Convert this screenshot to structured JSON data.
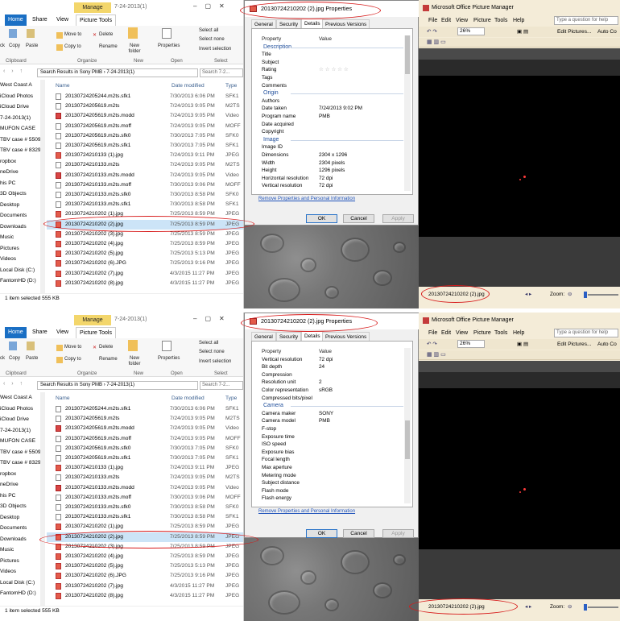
{
  "explorer": {
    "manage_tab": "Manage",
    "folder_title": "7-24-2013(1)",
    "tabs": [
      "Home",
      "Share",
      "View",
      "Picture Tools"
    ],
    "ribbon": {
      "cut": "ck",
      "copy": "Copy",
      "paste": "Paste",
      "move_to": "Move to",
      "copy_to": "Copy to",
      "delete": "Delete",
      "rename": "Rename",
      "new_folder": "New folder",
      "properties": "Properties",
      "select_all": "Select all",
      "select_none": "Select none",
      "invert_selection": "Invert selection",
      "groups": [
        "Clipboard",
        "Organize",
        "New",
        "Open",
        "Select"
      ]
    },
    "address": "Search Results in Sony PMB  ›  7-24-2013(1)",
    "search_placeholder": "Search 7-2...",
    "nav_items": [
      "West Coast A",
      "iCloud Photos",
      "iCloud Drive",
      "7-24-2013(1)",
      "MUFON CASE",
      "TBV case # 5509",
      "TBV case # 8329",
      "ropbox",
      "neDrive",
      "his PC",
      "3D Objects",
      "Desktop",
      "Documents",
      "Downloads",
      "Music",
      "Pictures",
      "Videos",
      "Local Disk (C:)",
      "FantomHD (D:)"
    ],
    "columns": {
      "name": "Name",
      "date": "Date modified",
      "type": "Type"
    },
    "files": [
      {
        "name": "20130724205244.m2ts.sfk1",
        "date": "7/30/2013 6:06 PM",
        "type": "SFK1",
        "kind": "doc"
      },
      {
        "name": "20130724205619.m2ts",
        "date": "7/24/2013 9:05 PM",
        "type": "M2TS",
        "kind": "doc"
      },
      {
        "name": "20130724205619.m2ts.modd",
        "date": "7/24/2013 9:05 PM",
        "type": "Video",
        "kind": "vid"
      },
      {
        "name": "20130724205619.m2ts.moff",
        "date": "7/24/2013 9:05 PM",
        "type": "MOFF",
        "kind": "doc"
      },
      {
        "name": "20130724205619.m2ts.sfk0",
        "date": "7/30/2013 7:05 PM",
        "type": "SFK0",
        "kind": "doc"
      },
      {
        "name": "20130724205619.m2ts.sfk1",
        "date": "7/30/2013 7:05 PM",
        "type": "SFK1",
        "kind": "doc"
      },
      {
        "name": "20130724210133 (1).jpg",
        "date": "7/24/2013 9:11 PM",
        "type": "JPEG",
        "kind": "jpg"
      },
      {
        "name": "20130724210133.m2ts",
        "date": "7/24/2013 9:05 PM",
        "type": "M2TS",
        "kind": "doc"
      },
      {
        "name": "20130724210133.m2ts.modd",
        "date": "7/24/2013 9:05 PM",
        "type": "Video",
        "kind": "vid"
      },
      {
        "name": "20130724210133.m2ts.moff",
        "date": "7/30/2013 9:06 PM",
        "type": "MOFF",
        "kind": "doc"
      },
      {
        "name": "20130724210133.m2ts.sfk0",
        "date": "7/30/2013 8:58 PM",
        "type": "SFK0",
        "kind": "doc"
      },
      {
        "name": "20130724210133.m2ts.sfk1",
        "date": "7/30/2013 8:58 PM",
        "type": "SFK1",
        "kind": "doc"
      },
      {
        "name": "20130724210202 (1).jpg",
        "date": "7/25/2013 8:59 PM",
        "type": "JPEG",
        "kind": "jpg"
      },
      {
        "name": "20130724210202 (2).jpg",
        "date": "7/25/2013 8:59 PM",
        "type": "JPEG",
        "kind": "jpg"
      },
      {
        "name": "20130724210202 (3).jpg",
        "date": "7/25/2013 8:59 PM",
        "type": "JPEG",
        "kind": "jpg"
      },
      {
        "name": "20130724210202 (4).jpg",
        "date": "7/25/2013 8:59 PM",
        "type": "JPEG",
        "kind": "jpg"
      },
      {
        "name": "20130724210202 (5).jpg",
        "date": "7/25/2013 5:13 PM",
        "type": "JPEG",
        "kind": "jpg"
      },
      {
        "name": "20130724210202 (6).JPG",
        "date": "7/25/2013 9:16 PM",
        "type": "JPEG",
        "kind": "jpg"
      },
      {
        "name": "20130724210202 (7).jpg",
        "date": "4/3/2015 11:27 PM",
        "type": "JPEG",
        "kind": "jpg"
      },
      {
        "name": "20130724210202 (8).jpg",
        "date": "4/3/2015 11:27 PM",
        "type": "JPEG",
        "kind": "jpg"
      }
    ],
    "status": "1 item selected  555 KB"
  },
  "dialog": {
    "title": "20130724210202 (2).jpg Properties",
    "tabs": [
      "General",
      "Security",
      "Details",
      "Previous Versions"
    ],
    "header_property": "Property",
    "header_value": "Value",
    "remove_link": "Remove Properties and Personal Information",
    "ok": "OK",
    "cancel": "Cancel",
    "apply": "Apply",
    "view1": [
      {
        "k": "Property",
        "v": "Value",
        "t": "hdr"
      },
      {
        "k": "Description",
        "v": "",
        "t": "sec"
      },
      {
        "k": "Title",
        "v": ""
      },
      {
        "k": "Subject",
        "v": ""
      },
      {
        "k": "Rating",
        "v": "☆☆☆☆☆",
        "t": "stars"
      },
      {
        "k": "Tags",
        "v": ""
      },
      {
        "k": "Comments",
        "v": ""
      },
      {
        "k": "Origin",
        "v": "",
        "t": "sec"
      },
      {
        "k": "Authors",
        "v": ""
      },
      {
        "k": "Date taken",
        "v": "7/24/2013 9:02 PM"
      },
      {
        "k": "Program name",
        "v": "PMB"
      },
      {
        "k": "Date acquired",
        "v": ""
      },
      {
        "k": "Copyright",
        "v": ""
      },
      {
        "k": "Image",
        "v": "",
        "t": "sec"
      },
      {
        "k": "Image ID",
        "v": ""
      },
      {
        "k": "Dimensions",
        "v": "2304 x 1296"
      },
      {
        "k": "Width",
        "v": "2304 pixels"
      },
      {
        "k": "Height",
        "v": "1296 pixels"
      },
      {
        "k": "Horizontal resolution",
        "v": "72 dpi"
      },
      {
        "k": "Vertical resolution",
        "v": "72 dpi"
      }
    ],
    "view2": [
      {
        "k": "Property",
        "v": "Value",
        "t": "hdr"
      },
      {
        "k": "Vertical resolution",
        "v": "72 dpi"
      },
      {
        "k": "Bit depth",
        "v": "24"
      },
      {
        "k": "Compression",
        "v": ""
      },
      {
        "k": "Resolution unit",
        "v": "2"
      },
      {
        "k": "Color representation",
        "v": "sRGB"
      },
      {
        "k": "Compressed bits/pixel",
        "v": ""
      },
      {
        "k": "Camera",
        "v": "",
        "t": "sec"
      },
      {
        "k": "Camera maker",
        "v": "SONY"
      },
      {
        "k": "Camera model",
        "v": "PMB"
      },
      {
        "k": "F-stop",
        "v": ""
      },
      {
        "k": "Exposure time",
        "v": ""
      },
      {
        "k": "ISO speed",
        "v": ""
      },
      {
        "k": "Exposure bias",
        "v": ""
      },
      {
        "k": "Focal length",
        "v": ""
      },
      {
        "k": "Max aperture",
        "v": ""
      },
      {
        "k": "Metering mode",
        "v": ""
      },
      {
        "k": "Subject distance",
        "v": ""
      },
      {
        "k": "Flash mode",
        "v": ""
      },
      {
        "k": "Flash energy",
        "v": ""
      }
    ]
  },
  "picture_manager": {
    "title": "Microsoft Office Picture Manager",
    "menu": [
      "File",
      "Edit",
      "View",
      "Picture",
      "Tools",
      "Help"
    ],
    "question_placeholder": "Type a question for help",
    "zoom_percent": "26%",
    "edit_pictures": "Edit Pictures...",
    "auto_correct": "Auto Co",
    "status_file": "20130724210202 (2).jpg",
    "zoom_label": "Zoom:",
    "colors": {
      "selection": "#cce4f7",
      "annotation": "#d71a1a",
      "accent": "#1a6fc4"
    }
  }
}
